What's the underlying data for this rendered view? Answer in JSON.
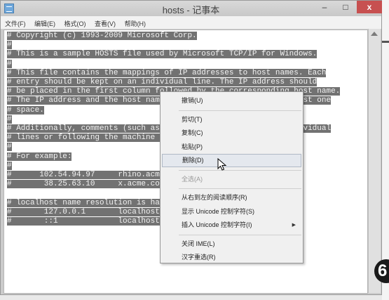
{
  "window": {
    "title": "hosts - 记事本",
    "controls": {
      "minimize": "–",
      "maximize": "□",
      "close": "x"
    }
  },
  "menubar": [
    "文件(F)",
    "编辑(E)",
    "格式(O)",
    "查看(V)",
    "帮助(H)"
  ],
  "editor": {
    "lines": [
      {
        "text": "# Copyright (c) 1993-2009 Microsoft Corp."
      },
      {
        "text": "#"
      },
      {
        "text": "# This is a sample HOSTS file used by Microsoft TCP/IP for Windows."
      },
      {
        "text": "#"
      },
      {
        "text": "# This file contains the mappings of IP addresses to host names. Each"
      },
      {
        "text": "# entry should be kept on an individual line. The IP address should"
      },
      {
        "text": "# be placed in the first column followed by the corresponding host name."
      },
      {
        "text": "# The IP address and the host name should be separated by at least one"
      },
      {
        "text": "# space."
      },
      {
        "text": "#"
      },
      {
        "text": "# Additionally, comments (such as these) may be inserted on individual"
      },
      {
        "text": "# lines or following the machine name denoted by a '#' symbol."
      },
      {
        "text": "#"
      },
      {
        "text": "# For example:"
      },
      {
        "text": "#"
      },
      {
        "text": "#      102.54.94.97     rhino.acme.com          # source server"
      },
      {
        "text": "#       38.25.63.10     x.acme.com              # x client host"
      },
      {
        "text": ""
      },
      {
        "text": "# localhost name resolution is handled within DNS itself."
      },
      {
        "text": "#       127.0.0.1       localhost"
      },
      {
        "text": "#       ::1             localhost"
      }
    ]
  },
  "context_menu": {
    "items": [
      {
        "label": "撤销(U)",
        "enabled": true
      },
      {
        "separator": true
      },
      {
        "label": "剪切(T)",
        "enabled": true
      },
      {
        "label": "复制(C)",
        "enabled": true
      },
      {
        "label": "粘贴(P)",
        "enabled": true
      },
      {
        "label": "删除(D)",
        "enabled": true,
        "hovered": true
      },
      {
        "separator": true
      },
      {
        "label": "全选(A)",
        "enabled": false
      },
      {
        "separator": true
      },
      {
        "label": "从右到左的阅读顺序(R)",
        "enabled": true
      },
      {
        "label": "显示 Unicode 控制字符(S)",
        "enabled": true
      },
      {
        "label": "插入 Unicode 控制字符(I)",
        "enabled": true,
        "submenu": true,
        "submenu_arrow": "▶"
      },
      {
        "separator": true
      },
      {
        "label": "关闭 IME(L)",
        "enabled": true
      },
      {
        "label": "汉字重选(R)",
        "enabled": true
      }
    ]
  },
  "step_badge": "6",
  "colors": {
    "selection": "#727272",
    "selection_text": "#f3f3f3",
    "close_button": "#c75050",
    "menu_background": "#f0f0f0"
  }
}
